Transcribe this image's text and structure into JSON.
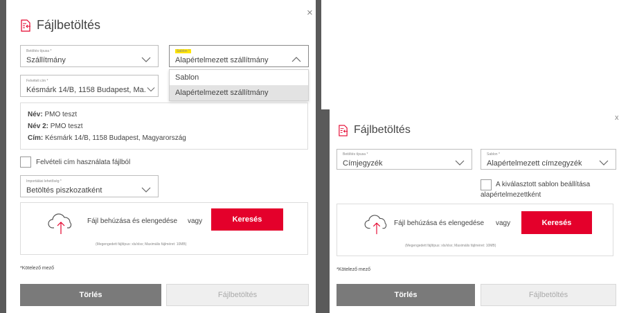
{
  "left": {
    "title": "Fájlbetöltés",
    "close": "×",
    "load_type": {
      "label": "Betöltés típusa *",
      "value": "Szállítmány"
    },
    "template": {
      "label": "Sablon *",
      "value": "Alapértelmezett szállítmány"
    },
    "template_options": [
      "Sablon",
      "Alapértelmezett szállítmány"
    ],
    "pickup": {
      "label": "Felvételi cím *",
      "value": "Késmárk 14/B, 1158 Budapest, Ma..."
    },
    "info": {
      "name_label": "Név:",
      "name_value": "PMO teszt",
      "name2_label": "Név 2:",
      "name2_value": "PMO teszt",
      "addr_label": "Cím:",
      "addr_value": "Késmárk 14/B, 1158 Budapest, Magyarország"
    },
    "use_pickup_checkbox": "Felvételi cím használata fájlból",
    "import_mode": {
      "label": "Importálási lehetőség *",
      "value": "Betöltés piszkozatként"
    },
    "upload_text": "Fájl behúzása és elengedése",
    "or": "vagy",
    "search_btn": "Keresés",
    "hint": "(Megengedett fájltípus: xls/xlsx; Maximális fájlméret: 10MB)",
    "required": "*Kötelező mező",
    "delete_btn": "Törlés",
    "upload_btn": "Fájlbetöltés"
  },
  "right": {
    "title": "Fájlbetöltés",
    "close": "x",
    "load_type": {
      "label": "Betöltés típusa *",
      "value": "Címjegyzék"
    },
    "template": {
      "label": "Sablon *",
      "value": "Alapértelmezett címzegyzék"
    },
    "default_checkbox_line1": "A kiválasztott sablon beállítása",
    "default_checkbox_line2": "alapértelmezettként",
    "upload_text": "Fájl behúzása és elengedése",
    "or": "vagy",
    "search_btn": "Keresés",
    "hint": "(Megengedett fájltípus: xls/xlsx; Maximális fájlméret: 10MB)",
    "required": "*Kötelező mező",
    "delete_btn": "Törlés",
    "upload_btn": "Fájlbetöltés"
  },
  "colors": {
    "accent": "#e4002b",
    "highlight": "#ffe500",
    "backdrop": "#5a5a5a"
  }
}
